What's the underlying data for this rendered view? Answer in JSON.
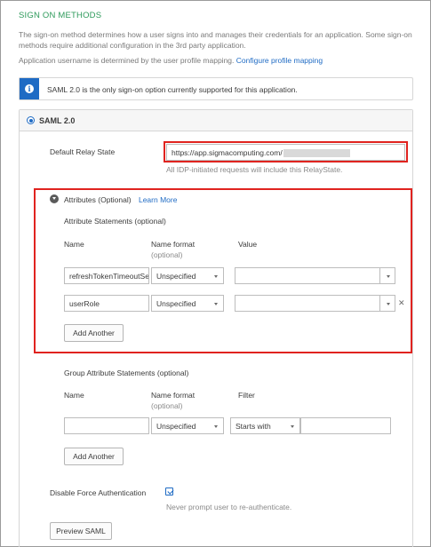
{
  "section_title": "SIGN ON METHODS",
  "description": "The sign-on method determines how a user signs into and manages their credentials for an application. Some sign-on methods require additional configuration in the 3rd party application.",
  "username_note": {
    "text": "Application username is determined by the user profile mapping.",
    "link": "Configure profile mapping"
  },
  "info": {
    "icon": "info-icon",
    "text": "SAML 2.0 is the only sign-on option currently supported for this application."
  },
  "saml": {
    "label": "SAML 2.0",
    "selected": true,
    "relay_state": {
      "label": "Default Relay State",
      "value": "https://app.sigmacomputing.com/",
      "hint": "All IDP-initiated requests will include this RelayState."
    },
    "attributes": {
      "toggle_label": "Attributes (Optional)",
      "learn_more": "Learn More",
      "statements_title": "Attribute Statements (optional)",
      "col_name": "Name",
      "col_format": "Name format",
      "col_format_sub": "(optional)",
      "col_value": "Value",
      "rows": [
        {
          "name": "refreshTokenTimeoutSeconds",
          "format": "Unspecified",
          "value": ""
        },
        {
          "name": "userRole",
          "format": "Unspecified",
          "value": ""
        }
      ],
      "add_another": "Add Another"
    },
    "group_attributes": {
      "title": "Group Attribute Statements (optional)",
      "col_name": "Name",
      "col_format": "Name format",
      "col_format_sub": "(optional)",
      "col_filter": "Filter",
      "row": {
        "name": "",
        "format": "Unspecified",
        "filter": "Starts with",
        "filter_value": ""
      },
      "add_another": "Add Another"
    },
    "force_auth": {
      "label": "Disable Force Authentication",
      "checked": true,
      "hint": "Never prompt user to re-authenticate."
    },
    "preview_button": "Preview SAML"
  },
  "colors": {
    "accent": "#1f6bc4",
    "title_green": "#2d9a5a",
    "highlight_red": "#e0231f"
  }
}
